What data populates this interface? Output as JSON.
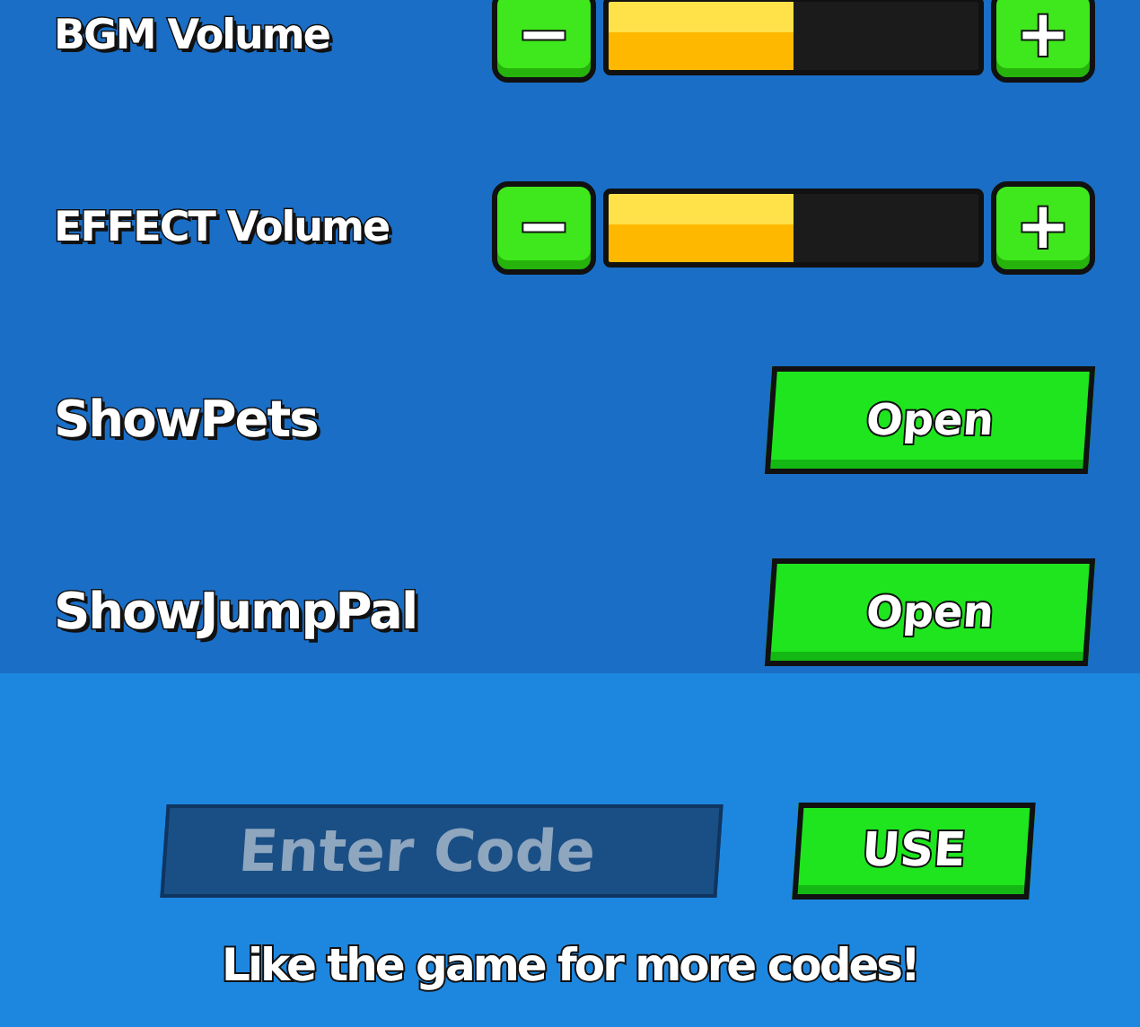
{
  "settings": [
    {
      "kind": "slider",
      "label": "BGM Volume",
      "minus": "−",
      "plus": "+",
      "level": 0.5
    },
    {
      "kind": "slider",
      "label": "EFFECT Volume",
      "minus": "−",
      "plus": "+",
      "level": 0.5
    },
    {
      "kind": "button",
      "label": "ShowPets",
      "button": "Open"
    },
    {
      "kind": "button",
      "label": "ShowJumpPal",
      "button": "Open"
    }
  ],
  "code": {
    "placeholder": "Enter Code",
    "button": "USE",
    "hint": "Like the game for more codes!"
  }
}
